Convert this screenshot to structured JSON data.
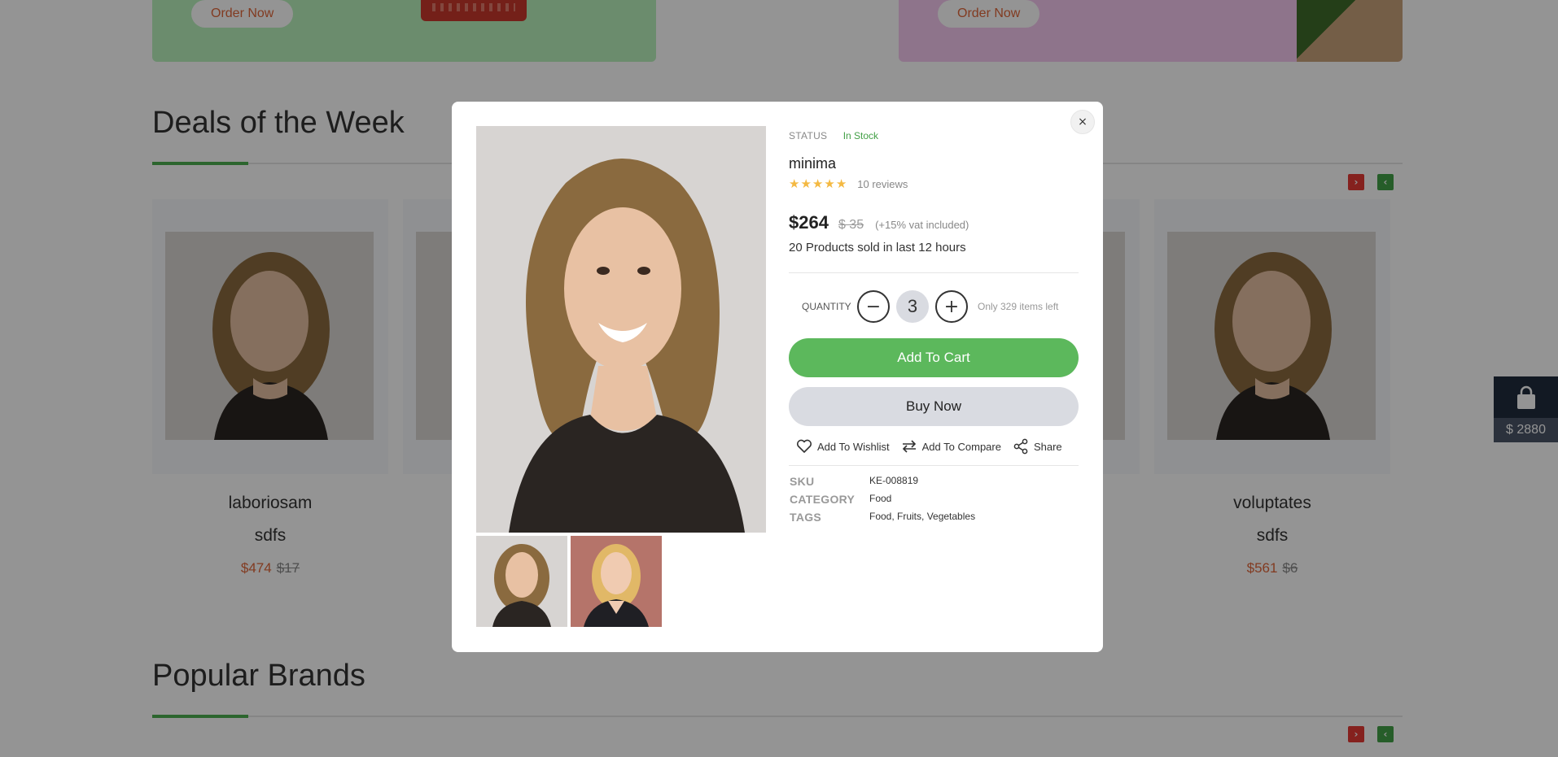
{
  "banners": {
    "left_button": "Order Now",
    "right_button": "Order Now"
  },
  "deals": {
    "title": "Deals of the Week",
    "products": [
      {
        "name": "laboriosam",
        "sub": "sdfs",
        "price": "$474",
        "old_price": "$17"
      },
      {
        "name": "voluptates",
        "sub": "sdfs",
        "price": "$561",
        "old_price": "$6"
      }
    ]
  },
  "brands": {
    "title": "Popular Brands"
  },
  "cart_widget": {
    "total": "$ 2880"
  },
  "modal": {
    "close": "×",
    "status_label": "STATUS",
    "status_value": "In Stock",
    "name": "minima",
    "rating": 5,
    "reviews": "10 reviews",
    "price": "$264",
    "old_price": "$ 35",
    "vat": "(+15% vat included)",
    "sold": "20 Products sold in last 12 hours",
    "quantity_label": "QUANTITY",
    "quantity_value": "3",
    "items_left": "Only 329 items left",
    "add_to_cart": "Add To Cart",
    "buy_now": "Buy Now",
    "wishlist": "Add To Wishlist",
    "compare": "Add To Compare",
    "share": "Share",
    "sku_label": "SKU",
    "sku_value": "KE-008819",
    "category_label": "CATEGORY",
    "category_value": "Food",
    "tags_label": "TAGS",
    "tags_value": "Food, Fruits, Vegetables"
  },
  "colors": {
    "accent_green": "#5cb85c",
    "status_green": "#43a047",
    "price_orange": "#e0663a",
    "star": "#f4b942"
  }
}
